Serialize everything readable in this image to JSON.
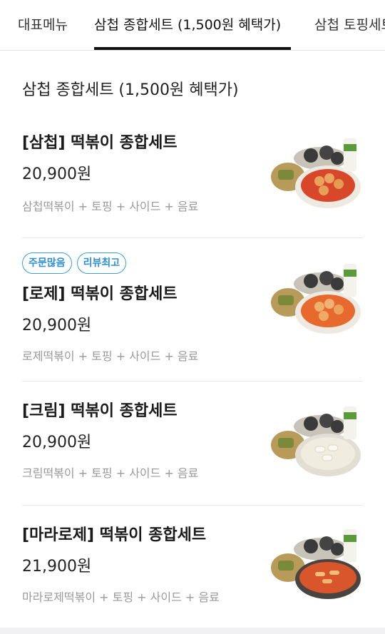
{
  "tabs": [
    {
      "label": "대표메뉴",
      "active": false
    },
    {
      "label": "삼첩 종합세트 (1,500원 혜택가)",
      "active": true
    },
    {
      "label": "삼첩 토핑세트",
      "active": false
    }
  ],
  "section": {
    "title": "삼첩 종합세트 (1,500원 혜택가)"
  },
  "items": [
    {
      "name": "[삼첩] 떡볶이 종합세트",
      "price": "20,900원",
      "desc": "삼첩떡볶이 + 토핑 + 사이드 + 음료",
      "badges": [],
      "image": "tteokbokki-set-photo",
      "sauce_color": "#d8472a"
    },
    {
      "name": "[로제] 떡볶이 종합세트",
      "price": "20,900원",
      "desc": "로제떡볶이 + 토핑 + 사이드 + 음료",
      "badges": [
        "주문많음",
        "리뷰최고"
      ],
      "image": "rose-tteokbokki-set-photo",
      "sauce_color": "#e8692e"
    },
    {
      "name": "[크림] 떡볶이 종합세트",
      "price": "20,900원",
      "desc": "크림떡볶이 + 토핑 + 사이드 + 음료",
      "badges": [],
      "image": "cream-tteokbokki-set-photo",
      "sauce_color": "#f1ece0"
    },
    {
      "name": "[마라로제] 떡볶이 종합세트",
      "price": "21,900원",
      "desc": "마라로제떡볶이 + 토핑 + 사이드 + 음료",
      "badges": [],
      "image": "mala-rose-tteokbokki-set-photo",
      "sauce_color": "#d9552b"
    }
  ]
}
